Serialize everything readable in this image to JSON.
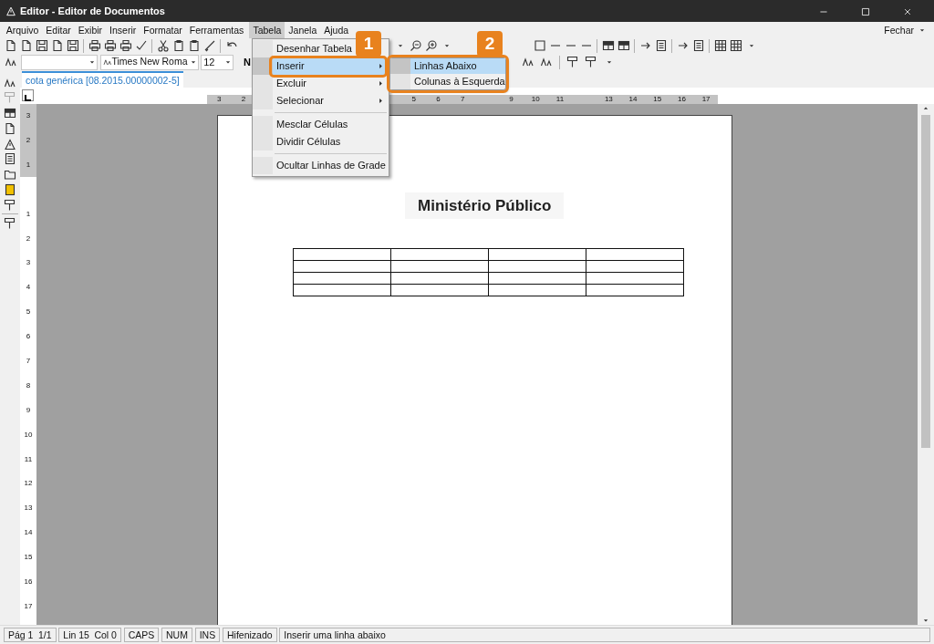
{
  "window": {
    "title": "Editor - Editor de Documentos"
  },
  "menu_bar": [
    {
      "label": "Arquivo",
      "selected": false
    },
    {
      "label": "Editar",
      "selected": false
    },
    {
      "label": "Exibir",
      "selected": false
    },
    {
      "label": "Inserir",
      "selected": false
    },
    {
      "label": "Formatar",
      "selected": false
    },
    {
      "label": "Ferramentas",
      "selected": false
    },
    {
      "label": "Tabela",
      "selected": true
    },
    {
      "label": "Janela",
      "selected": false
    },
    {
      "label": "Ajuda",
      "selected": false
    }
  ],
  "close_document": "Fechar",
  "format_toolbar": {
    "font": "Times New Roma",
    "size": "12",
    "bold": "N"
  },
  "document_tab": {
    "label": "cota genérica [08.2015.00000002-5]",
    "selected": true
  },
  "horizontal_ruler": [
    "3",
    "2",
    "5",
    "6",
    "7",
    "9",
    "10",
    "11",
    "13",
    "14",
    "15",
    "16",
    "17"
  ],
  "vertical_ruler": [
    "3",
    "2",
    "1",
    "1",
    "2",
    "3",
    "4",
    "5",
    "6",
    "7",
    "8",
    "9",
    "10",
    "11",
    "12",
    "13",
    "14",
    "15",
    "16",
    "17"
  ],
  "table_menu": [
    {
      "kind": "item",
      "label": "Desenhar Tabela",
      "selected": false
    },
    {
      "kind": "submenu",
      "label": "Inserir",
      "selected": true
    },
    {
      "kind": "submenu",
      "label": "Excluir",
      "selected": false
    },
    {
      "kind": "submenu",
      "label": "Selecionar",
      "selected": false
    },
    {
      "kind": "separator"
    },
    {
      "kind": "item",
      "label": "Mesclar Células",
      "selected": false
    },
    {
      "kind": "item",
      "label": "Dividir Células",
      "selected": false
    },
    {
      "kind": "separator"
    },
    {
      "kind": "item",
      "label": "Ocultar Linhas de Grade",
      "selected": false
    }
  ],
  "insert_submenu": [
    {
      "label": "Linhas Abaixo",
      "selected": true
    },
    {
      "label": "Colunas à Esquerda",
      "selected": false
    }
  ],
  "callouts": [
    "1",
    "2"
  ],
  "document": {
    "heading": "Ministério Público"
  },
  "status_bar": [
    [
      "Pág 1",
      "1/1"
    ],
    [
      "Lin 15",
      "Col 0"
    ],
    [
      "CAPS"
    ],
    [
      "NUM"
    ],
    [
      "INS"
    ],
    [
      "Hifenizado"
    ],
    [
      "Inserir uma linha abaixo"
    ]
  ]
}
